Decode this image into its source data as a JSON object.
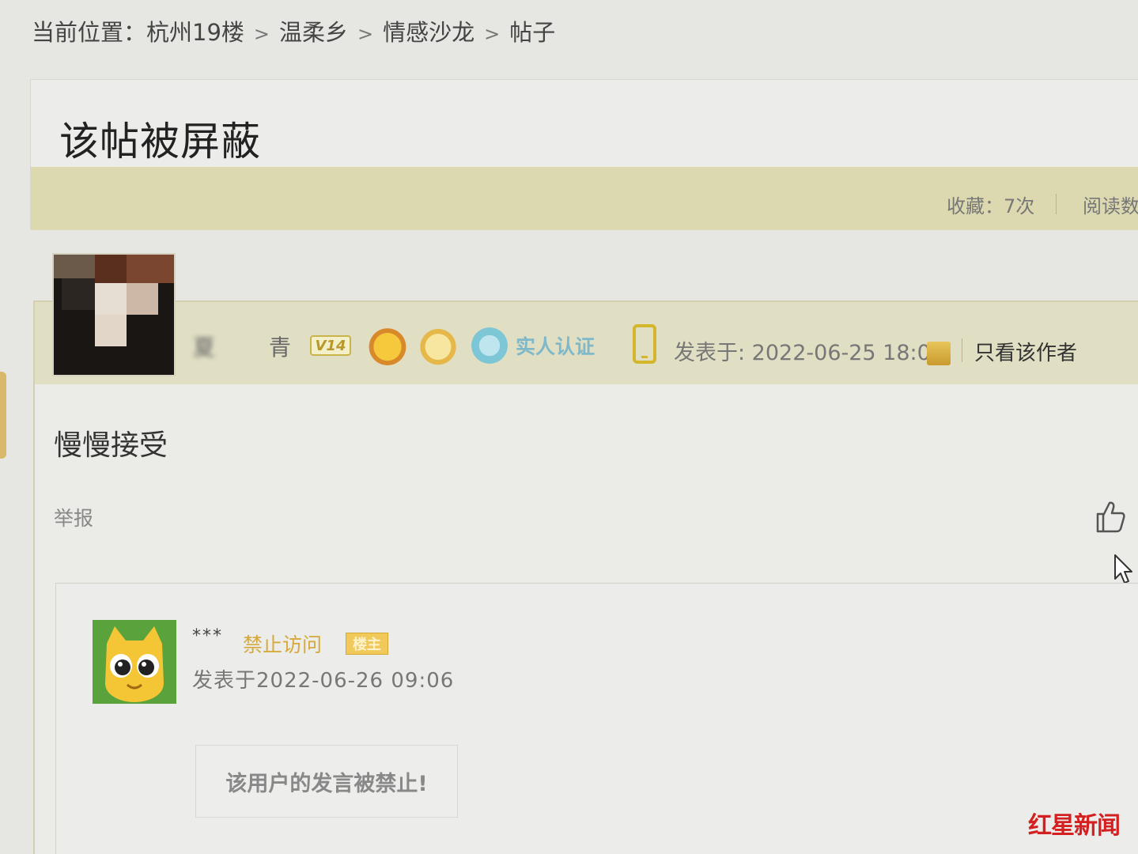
{
  "breadcrumb": {
    "prefix": "当前位置：",
    "items": [
      "杭州19楼",
      "温柔乡",
      "情感沙龙",
      "帖子"
    ],
    "separator": ">"
  },
  "title_box": {
    "title": "该帖被屏蔽",
    "stats": {
      "favorites": "收藏：7次",
      "reads": "阅读数"
    }
  },
  "post": {
    "author_name_obscured": "夏",
    "author_name_end": "青",
    "level_badge": "V14",
    "verify_label": "实人认证",
    "post_time": "发表于: 2022-06-25 18:03",
    "only_author": "只看该作者",
    "content": "慢慢接受",
    "report": "举报"
  },
  "reply": {
    "name": "***",
    "status": "禁止访问",
    "badge": "楼主",
    "time": "发表于2022-06-26 09:06",
    "banned_notice": "该用户的发言被禁止!"
  },
  "watermark": {
    "text": "红星新闻"
  },
  "colors": {
    "stats_bar": "#dcd9b0",
    "post_header": "#e0dec3",
    "badge_gold": "#d6a93a",
    "watermark_red": "#d42020"
  }
}
